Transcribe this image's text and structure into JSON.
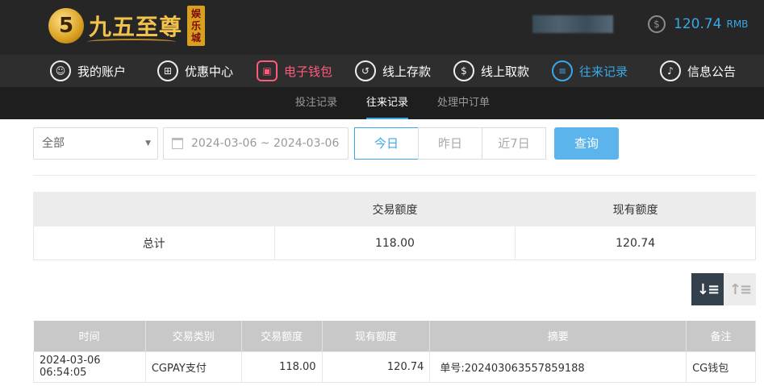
{
  "brand": {
    "name": "九五至尊",
    "badge": "娱乐城",
    "mark": "5"
  },
  "balance": {
    "amount": "120.74",
    "currency": "RMB",
    "icon": "dollar-coin-icon"
  },
  "main_nav": [
    {
      "label": "我的账户",
      "icon": "user-icon",
      "glyph": "☺"
    },
    {
      "label": "优惠中心",
      "icon": "gift-icon",
      "glyph": "⊞"
    },
    {
      "label": "电子钱包",
      "icon": "wallet-icon",
      "glyph": "▣",
      "active": true,
      "color": "#ff5a7a"
    },
    {
      "label": "线上存款",
      "icon": "deposit-icon",
      "glyph": "↺"
    },
    {
      "label": "线上取款",
      "icon": "withdraw-icon",
      "glyph": "$"
    },
    {
      "label": "往来记录",
      "icon": "records-icon",
      "glyph": "≡",
      "color": "#39a8e8"
    },
    {
      "label": "信息公告",
      "icon": "bell-icon",
      "glyph": "♪"
    }
  ],
  "sub_nav": [
    {
      "label": "投注记录"
    },
    {
      "label": "往来记录",
      "active": true
    },
    {
      "label": "处理中订单"
    }
  ],
  "filters": {
    "type_select": "全部",
    "date_range": "2024-03-06 ~ 2024-03-06",
    "quick_ranges": [
      "今日",
      "昨日",
      "近7日"
    ],
    "active_range": "今日",
    "query_label": "查询"
  },
  "summary": {
    "headers": [
      "",
      "交易额度",
      "现有额度"
    ],
    "row": [
      "总计",
      "118.00",
      "120.74"
    ]
  },
  "transactions": {
    "headers": [
      "时间",
      "交易类别",
      "交易额度",
      "现有额度",
      "摘要",
      "备注"
    ],
    "rows": [
      [
        "2024-03-06 06:54:05",
        "CGPAY支付",
        "118.00",
        "120.74",
        "单号:202403063557859188",
        "CG钱包"
      ]
    ]
  },
  "colors": {
    "accent": "#39a8e8",
    "highlight": "#ff5a7a",
    "header_bg": "#262626",
    "gold": "#f3c24d"
  }
}
